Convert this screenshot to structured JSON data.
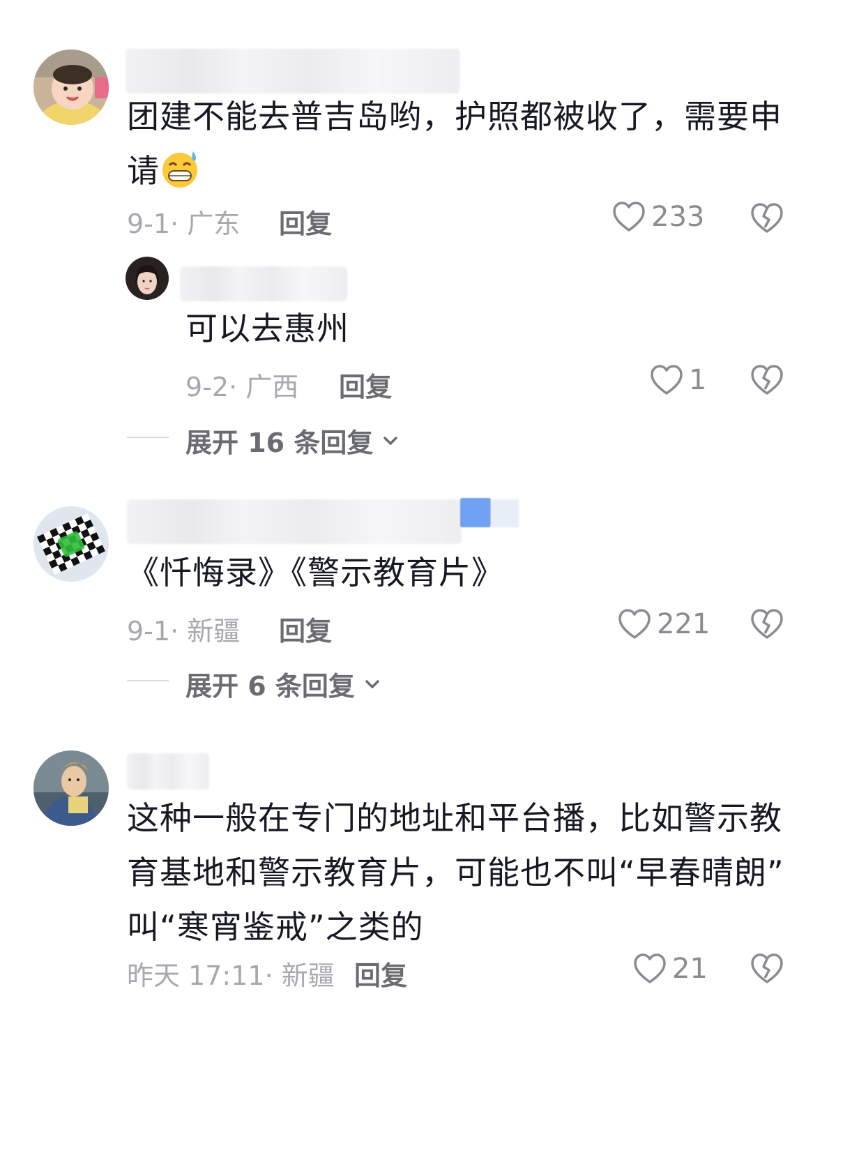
{
  "comments": [
    {
      "text_line1": "团建不能去普吉岛哟，护照都被收了，需要申",
      "text_line2": "请",
      "emoji": "grinning-sweat-emoji",
      "meta": "9-1· 广东",
      "reply_label": "回复",
      "likes": "233",
      "reply": {
        "text": "可以去惠州",
        "meta": "9-2· 广西",
        "reply_label": "回复",
        "likes": "1"
      },
      "expand_label": "展开 16 条回复"
    },
    {
      "text": "《忏悔录》《警示教育片》",
      "meta": "9-1· 新疆",
      "reply_label": "回复",
      "likes": "221",
      "expand_label": "展开 6 条回复"
    },
    {
      "text_line1": "这种一般在专门的地址和平台播，比如警示教",
      "text_line2": "育基地和警示教育片，可能也不叫“早春晴朗”",
      "text_line3": "叫“寒宵鉴戒”之类的",
      "meta": "昨天 17:11· 新疆",
      "reply_label": "回复",
      "likes": "21"
    }
  ],
  "colors": {
    "text": "#161823",
    "meta": "#a7a8ad",
    "action": "#6b6c72",
    "icon": "#8a8b91"
  }
}
